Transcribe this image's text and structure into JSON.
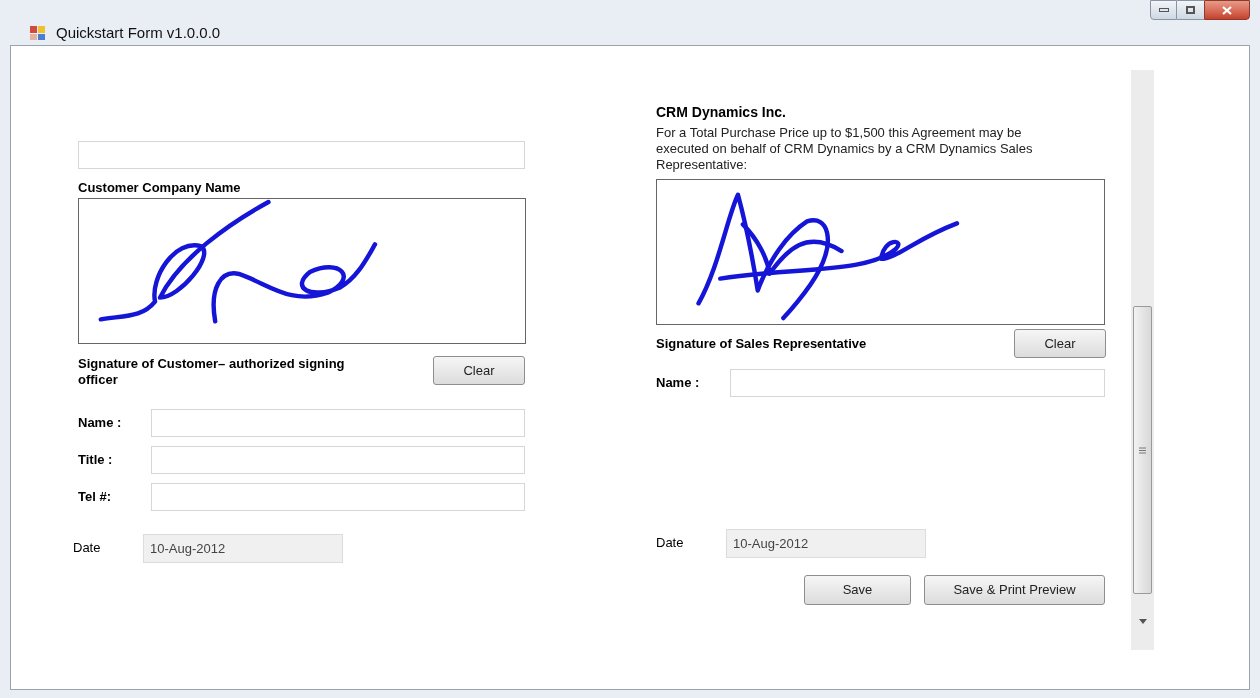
{
  "window": {
    "title": "Quickstart Form v1.0.0.0"
  },
  "customer": {
    "company_label": "Customer Company Name",
    "signature_label": "Signature of Customer– authorized signing officer",
    "clear_button": "Clear",
    "fields": [
      {
        "label": "Name :"
      },
      {
        "label": "Title :"
      },
      {
        "label": "Tel #:"
      }
    ],
    "date": {
      "label": "Date",
      "value": "10-Aug-2012",
      "disabled": true
    }
  },
  "representative": {
    "company": "CRM Dynamics Inc.",
    "note": "For a Total Purchase Price up to $1,500 this Agreement may be executed on behalf of CRM Dynamics by a CRM Dynamics Sales Representative:",
    "signature_label": "Signature of Sales Representative",
    "clear_button": "Clear",
    "fields": [
      {
        "label": "Name :"
      }
    ],
    "date": {
      "label": "Date",
      "value": "10-Aug-2012",
      "disabled": true
    }
  },
  "buttons": [
    "Save",
    "Save & Print Preview"
  ]
}
